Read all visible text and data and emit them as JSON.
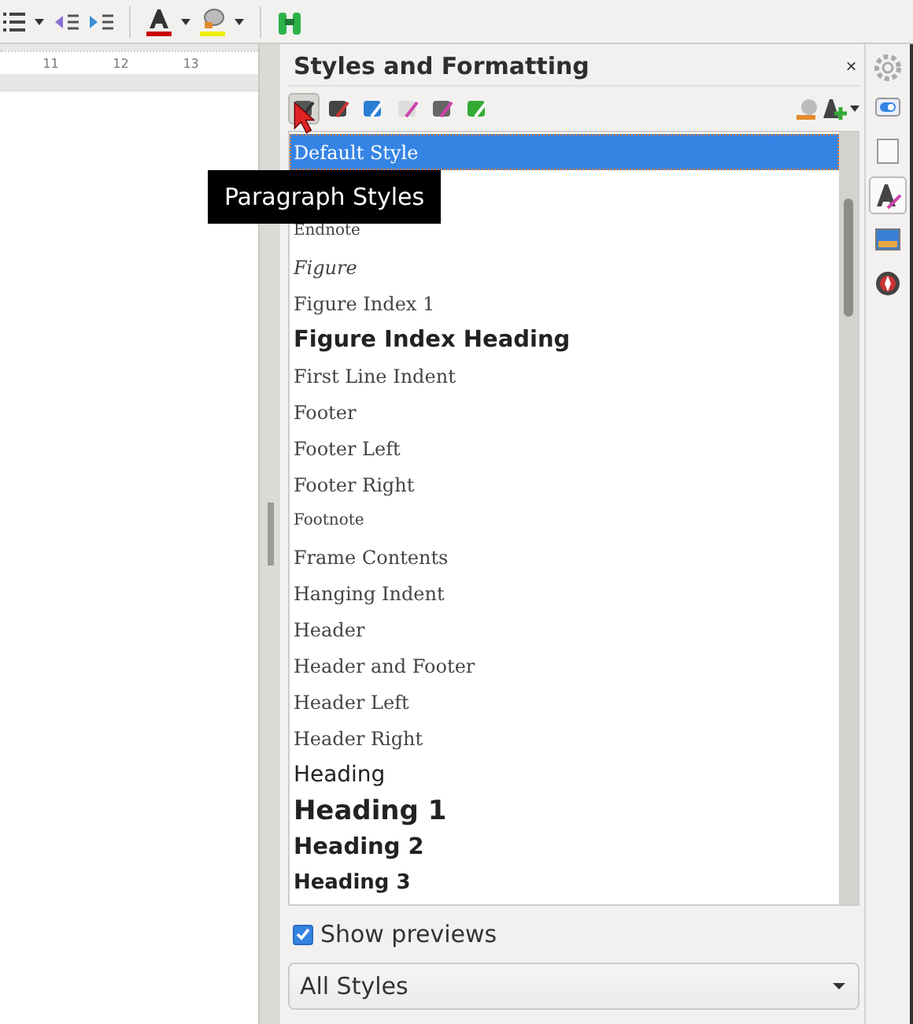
{
  "ruler": {
    "marks": [
      "11",
      "12",
      "13"
    ]
  },
  "panel": {
    "title": "Styles and Formatting",
    "close": "×",
    "categories": [
      {
        "selected": true
      },
      {
        "selected": false
      },
      {
        "selected": false
      },
      {
        "selected": false
      },
      {
        "selected": false
      },
      {
        "selected": false
      }
    ],
    "tooltip": "Paragraph Styles",
    "styles": [
      {
        "label": "Default Style",
        "kind": "serif",
        "selected": true
      },
      {
        "label": "Endnote",
        "kind": "serif-small",
        "selected": false
      },
      {
        "label": "Figure",
        "kind": "serif-italic",
        "selected": false
      },
      {
        "label": "Figure Index 1",
        "kind": "serif",
        "selected": false
      },
      {
        "label": "Figure Index Heading",
        "kind": "sans-bold-l",
        "selected": false
      },
      {
        "label": "First Line Indent",
        "kind": "serif",
        "selected": false
      },
      {
        "label": "Footer",
        "kind": "serif",
        "selected": false
      },
      {
        "label": "Footer Left",
        "kind": "serif",
        "selected": false
      },
      {
        "label": "Footer Right",
        "kind": "serif",
        "selected": false
      },
      {
        "label": "Footnote",
        "kind": "serif-small",
        "selected": false
      },
      {
        "label": "Frame Contents",
        "kind": "serif",
        "selected": false
      },
      {
        "label": "Hanging Indent",
        "kind": "serif",
        "selected": false
      },
      {
        "label": "Header",
        "kind": "serif",
        "selected": false
      },
      {
        "label": "Header and Footer",
        "kind": "serif",
        "selected": false
      },
      {
        "label": "Header Left",
        "kind": "serif",
        "selected": false
      },
      {
        "label": "Header Right",
        "kind": "serif",
        "selected": false
      },
      {
        "label": "Heading",
        "kind": "sans",
        "selected": false
      },
      {
        "label": "Heading 1",
        "kind": "sans-bold-xl",
        "selected": false
      },
      {
        "label": "Heading 2",
        "kind": "sans-bold-l",
        "selected": false
      },
      {
        "label": "Heading 3",
        "kind": "sans-bold-m",
        "selected": false
      }
    ],
    "show_previews": {
      "label": "Show previews",
      "checked": true
    },
    "filter": {
      "value": "All Styles"
    }
  },
  "sidebar": [
    {
      "kind": "toggle",
      "selected": false
    },
    {
      "kind": "page",
      "selected": false
    },
    {
      "kind": "styles",
      "selected": true
    },
    {
      "kind": "gallery",
      "selected": false
    },
    {
      "kind": "navigator",
      "selected": false
    }
  ]
}
